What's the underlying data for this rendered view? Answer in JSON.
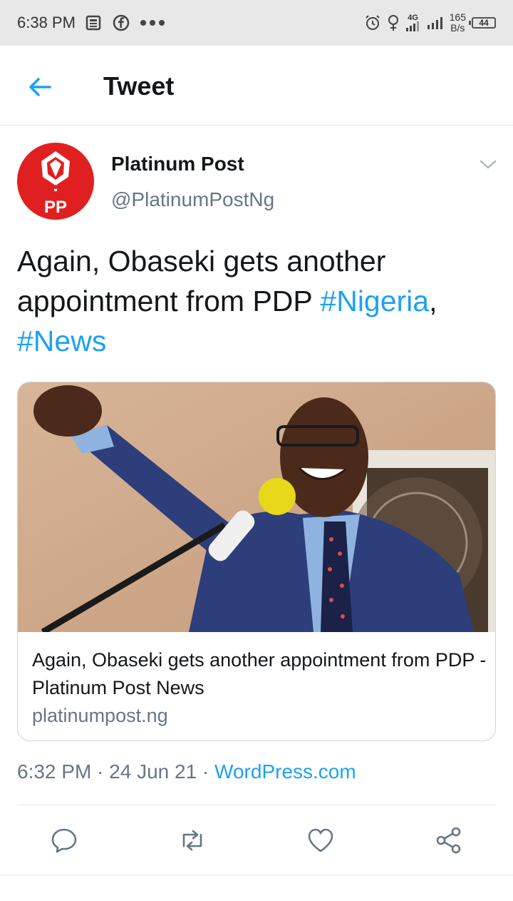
{
  "status_bar": {
    "time": "6:38 PM",
    "network_type": "4G",
    "speed_value": "165",
    "speed_unit": "B/s",
    "battery": "44"
  },
  "header": {
    "title": "Tweet"
  },
  "tweet": {
    "author_name": "Platinum Post",
    "author_handle": "@PlatinumPostNg",
    "avatar_initials": "PP",
    "text_plain": "Again, Obaseki gets another appointment from PDP ",
    "hashtag_1": "#Nigeria",
    "separator": ",",
    "hashtag_2": "#News",
    "timestamp": "6:32 PM · 24 Jun 21 · ",
    "source": "WordPress.com"
  },
  "link_card": {
    "title": "Again, Obaseki gets another appointment from PDP - Platinum Post News",
    "domain": "platinumpost.ng"
  },
  "colors": {
    "accent": "#1da1f2",
    "secondary_text": "#657786",
    "avatar_red": "#e02020"
  },
  "icons": {
    "back": "arrow-left-icon",
    "more": "chevron-down-icon",
    "reply": "reply-icon",
    "retweet": "retweet-icon",
    "like": "heart-icon",
    "share": "share-icon"
  }
}
